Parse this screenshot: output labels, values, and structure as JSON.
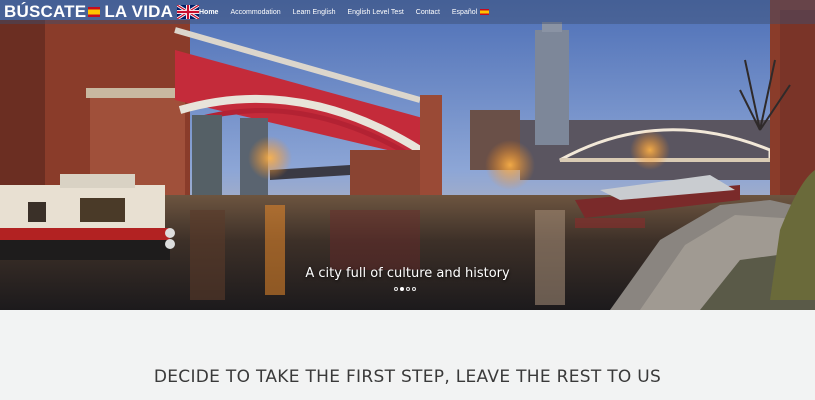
{
  "brand": {
    "part1": "BÚSCATE",
    "part2": "LA VIDA"
  },
  "nav": {
    "items": [
      {
        "label": "Home",
        "active": true
      },
      {
        "label": "Accommodation"
      },
      {
        "label": "Learn English"
      },
      {
        "label": "English Level Test"
      },
      {
        "label": "Contact"
      },
      {
        "label": "Español"
      }
    ]
  },
  "hero": {
    "caption": "A city full of culture and history",
    "slide_count": 4,
    "active_slide": 2
  },
  "section": {
    "heading": "DECIDE TO TAKE THE FIRST STEP, LEAVE THE REST TO US"
  },
  "colors": {
    "navbar": "#3c4e6e",
    "page_bg": "#f2f3f3",
    "heading_text": "#3a3a3a"
  },
  "icons": [
    "spain-flag-icon",
    "uk-flag-icon"
  ]
}
